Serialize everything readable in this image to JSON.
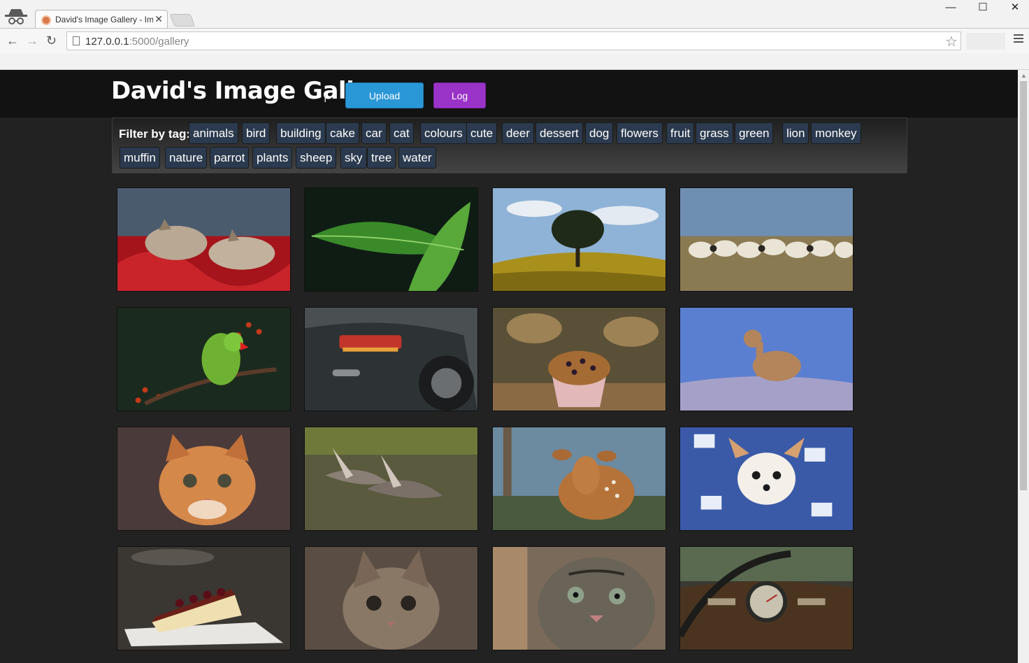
{
  "browser": {
    "tab_title": "David's Image Gallery - Im",
    "tab_close": "✕",
    "url_host": "127.0.0.1",
    "url_path": ":5000/gallery",
    "window_minimize": "—",
    "window_maximize": "☐",
    "window_close": "✕",
    "back": "←",
    "forward": "→",
    "reload": "↻",
    "bookmark_star": "☆"
  },
  "header": {
    "title": "David's Image Gallery",
    "upload_label": "Upload Image",
    "logout_label": "Log Out",
    "upload_color": "#2a97d7",
    "logout_color": "#9a33c7"
  },
  "filter": {
    "label": "Filter by tag:",
    "tags": [
      "animals",
      "bird",
      "building",
      "cake",
      "car",
      "cat",
      "colours",
      "cute",
      "deer",
      "dessert",
      "dog",
      "flowers",
      "fruit",
      "grass",
      "green",
      "lion",
      "monkey",
      "muffin",
      "nature",
      "parrot",
      "plants",
      "sheep",
      "sky",
      "tree",
      "water"
    ]
  },
  "gallery": {
    "images": [
      {
        "icon": "sleeping-kittens"
      },
      {
        "icon": "green-leaf"
      },
      {
        "icon": "tree-on-hill"
      },
      {
        "icon": "sheep-flock"
      },
      {
        "icon": "parrot"
      },
      {
        "icon": "car-rear"
      },
      {
        "icon": "muffin"
      },
      {
        "icon": "cougar"
      },
      {
        "icon": "kitten-face"
      },
      {
        "icon": "flying-geese"
      },
      {
        "icon": "fawn"
      },
      {
        "icon": "chihuahua-in-blanket"
      },
      {
        "icon": "cheesecake"
      },
      {
        "icon": "kitten-close-up"
      },
      {
        "icon": "tabby-cat"
      },
      {
        "icon": "car-dashboard"
      }
    ]
  }
}
